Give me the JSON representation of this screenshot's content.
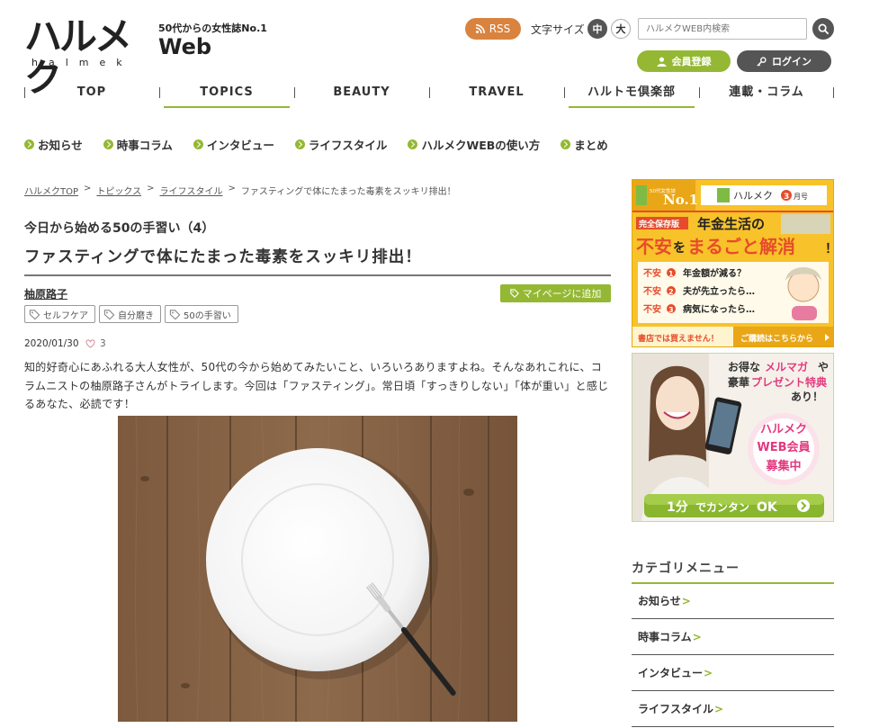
{
  "header": {
    "logo_jp": "ハルメク",
    "logo_en": "halmek",
    "logo_web": "Web",
    "tagline": "50代からの女性誌No.1",
    "rss_label": "RSS",
    "font_size_label": "文字サイズ",
    "font_size_mid": "中",
    "font_size_big": "大",
    "search_placeholder": "ハルメクWEB内検索",
    "member_label": "会員登録",
    "login_label": "ログイン"
  },
  "gnav": {
    "items": [
      {
        "label": "TOP",
        "active": false
      },
      {
        "label": "TOPICS",
        "active": true
      },
      {
        "label": "BEAUTY",
        "active": false
      },
      {
        "label": "TRAVEL",
        "active": false
      },
      {
        "label": "ハルトモ倶楽部",
        "active": true
      },
      {
        "label": "連載・コラム",
        "active": false
      }
    ]
  },
  "subnav": {
    "items": [
      "お知らせ",
      "時事コラム",
      "インタビュー",
      "ライフスタイル",
      "ハルメクWEBの使い方",
      "まとめ"
    ]
  },
  "breadcrumb": {
    "items": [
      "ハルメクTOP",
      "トピックス",
      "ライフスタイル"
    ],
    "separator": ">",
    "current": "ファスティングで体にたまった毒素をスッキリ排出！"
  },
  "article": {
    "series": "今日から始める50の手習い（4）",
    "title": "ファスティングで体にたまった毒素をスッキリ排出！",
    "author": "柚原路子",
    "mypage_label": "マイページに追加",
    "tags": [
      "セルフケア",
      "自分磨き",
      "50の手習い"
    ],
    "date": "2020/01/30",
    "likes": "3",
    "lead": "知的好奇心にあふれる大人女性が、50代の今から始めてみたいこと、いろいろありますよね。そんなあれこれに、コラムニストの柚原路子さんがトライします。今回は「ファスティング」。常日頃「すっきりしない」「体が重い」と感じるあなた、必読です！"
  },
  "ad1": {
    "badge_small": "50代女性誌",
    "badge_no1": "No.1",
    "magazine": "ハルメク",
    "month": "3",
    "month_suffix": "月号",
    "tag": "完全保存版",
    "headline1": "年金生活の",
    "headline2_a": "不安",
    "headline2_b": "を",
    "headline2_c": "まるごと解消",
    "headline2_d": "！",
    "points": [
      {
        "label": "不安",
        "num": "1",
        "text": "年金額が減る？"
      },
      {
        "label": "不安",
        "num": "2",
        "text": "夫が先立ったら…"
      },
      {
        "label": "不安",
        "num": "3",
        "text": "病気になったら…"
      }
    ],
    "footer_left": "書店では買えません！",
    "footer_right": "ご購読はこちらから"
  },
  "ad2": {
    "line1_a": "お得な",
    "line1_b": "メルマガ",
    "line1_c": "や",
    "line2_a": "豪華",
    "line2_b": "プレゼント特典",
    "line3": "あり！",
    "circle1": "ハルメク",
    "circle2": "WEB会員",
    "circle3": "募集中",
    "cta_a": "1分",
    "cta_b": "でカンタン",
    "cta_c": "OK"
  },
  "sidebar": {
    "heading": "カテゴリメニュー",
    "categories": [
      "お知らせ",
      "時事コラム",
      "インタビュー",
      "ライフスタイル"
    ]
  },
  "colors": {
    "accent_green": "#94b833",
    "rss_orange": "#d9833e",
    "dark_gray": "#555555"
  }
}
